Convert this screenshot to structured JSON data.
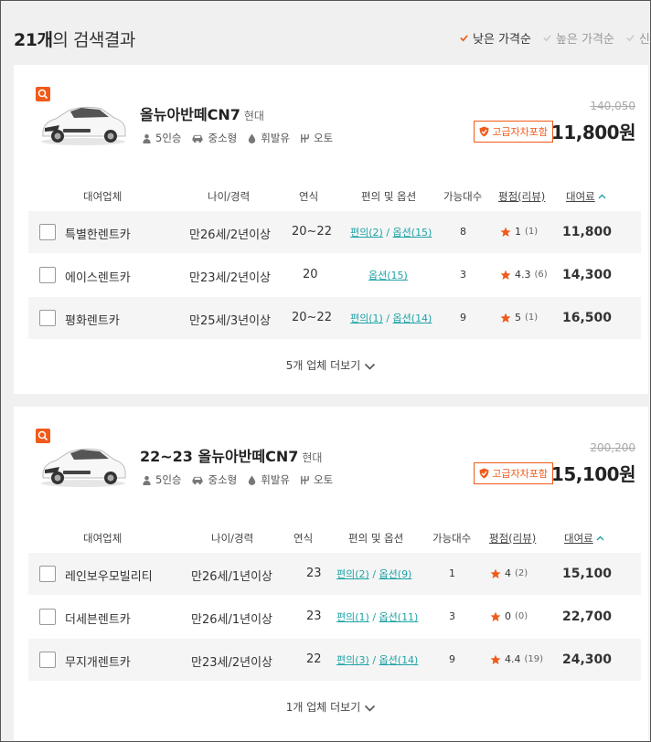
{
  "header": {
    "count": "21개",
    "title_suffix": "의 검색결과",
    "sort": [
      {
        "label": "낮은 가격순",
        "active": true
      },
      {
        "label": "높은 가격순",
        "active": false
      },
      {
        "label": "신차순",
        "active": false
      }
    ]
  },
  "table_headers": {
    "company": "대여업체",
    "age": "나이/경력",
    "year": "연식",
    "options": "편의 및 옵션",
    "available": "가능대수",
    "rating": "평점(리뷰)",
    "fee": "대여료"
  },
  "cars": [
    {
      "name": "올뉴아반떼CN7",
      "maker": "현대",
      "specs": {
        "seats": "5인승",
        "size": "중소형",
        "fuel": "휘발유",
        "trans": "오토"
      },
      "orig_price": "140,050",
      "insurance": "고급자차포함",
      "price": "11,800원",
      "rows": [
        {
          "company": "특별한렌트카",
          "age": "만26세/2년이상",
          "year": "20~22",
          "opt_a": "편의(2)",
          "sep": " / ",
          "opt_b": "옵션(15)",
          "available": "8",
          "rating": "1",
          "reviews": "(1)",
          "fee": "11,800"
        },
        {
          "company": "에이스렌트카",
          "age": "만23세/2년이상",
          "year": "20",
          "opt_a": "",
          "sep": "",
          "opt_b": "옵션(15)",
          "available": "3",
          "rating": "4.3",
          "reviews": "(6)",
          "fee": "14,300"
        },
        {
          "company": "평화렌트카",
          "age": "만25세/3년이상",
          "year": "20~22",
          "opt_a": "편의(1)",
          "sep": " / ",
          "opt_b": "옵션(14)",
          "available": "9",
          "rating": "5",
          "reviews": "(1)",
          "fee": "16,500"
        }
      ],
      "more": "5개 업체 더보기"
    },
    {
      "name": "22~23 올뉴아반떼CN7",
      "maker": "현대",
      "specs": {
        "seats": "5인승",
        "size": "중소형",
        "fuel": "휘발유",
        "trans": "오토"
      },
      "orig_price": "200,200",
      "insurance": "고급자차포함",
      "price": "15,100원",
      "rows": [
        {
          "company": "레인보우모빌리티",
          "age": "만26세/1년이상",
          "year": "23",
          "opt_a": "편의(2)",
          "sep": " / ",
          "opt_b": "옵션(9)",
          "available": "1",
          "rating": "4",
          "reviews": "(2)",
          "fee": "15,100"
        },
        {
          "company": "더세븐렌트카",
          "age": "만26세/1년이상",
          "year": "23",
          "opt_a": "편의(1)",
          "sep": " / ",
          "opt_b": "옵션(11)",
          "available": "3",
          "rating": "0",
          "reviews": "(0)",
          "fee": "22,700"
        },
        {
          "company": "무지개렌트카",
          "age": "만23세/2년이상",
          "year": "22",
          "opt_a": "편의(3)",
          "sep": " / ",
          "opt_b": "옵션(14)",
          "available": "9",
          "rating": "4.4",
          "reviews": "(19)",
          "fee": "24,300"
        }
      ],
      "more": "1개 업체 더보기"
    }
  ],
  "colors": {
    "accent": "#f05a1a",
    "link": "#1fa3a6",
    "sort_check": "#f05a1a"
  },
  "icons": [
    "search-icon",
    "car-image",
    "person-icon",
    "car-size-icon",
    "fuel-drop-icon",
    "gear-shift-icon",
    "shield-icon",
    "star-icon",
    "chevron-down-icon",
    "chevron-up-icon",
    "check-icon"
  ]
}
